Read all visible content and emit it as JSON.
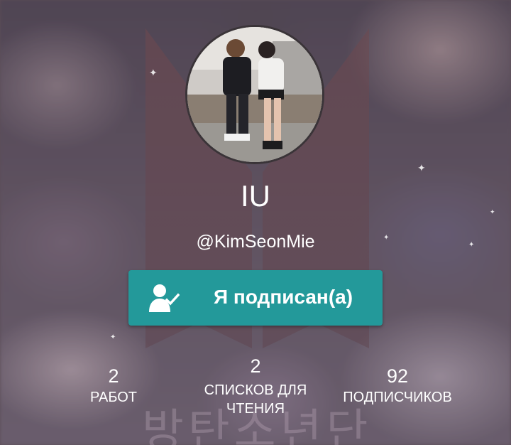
{
  "profile": {
    "name": "IU",
    "handle": "@KimSeonMie"
  },
  "follow_button": {
    "label": "Я подписан(а)",
    "icon": "user-check-icon",
    "color": "#23999a"
  },
  "stats": [
    {
      "value": "2",
      "label": "РАБОТ"
    },
    {
      "value": "2",
      "label": "СПИСКОВ ДЛЯ ЧТЕНИЯ"
    },
    {
      "value": "92",
      "label": "ПОДПИСЧИКОВ"
    }
  ],
  "background": {
    "text": "방탄소년단"
  }
}
